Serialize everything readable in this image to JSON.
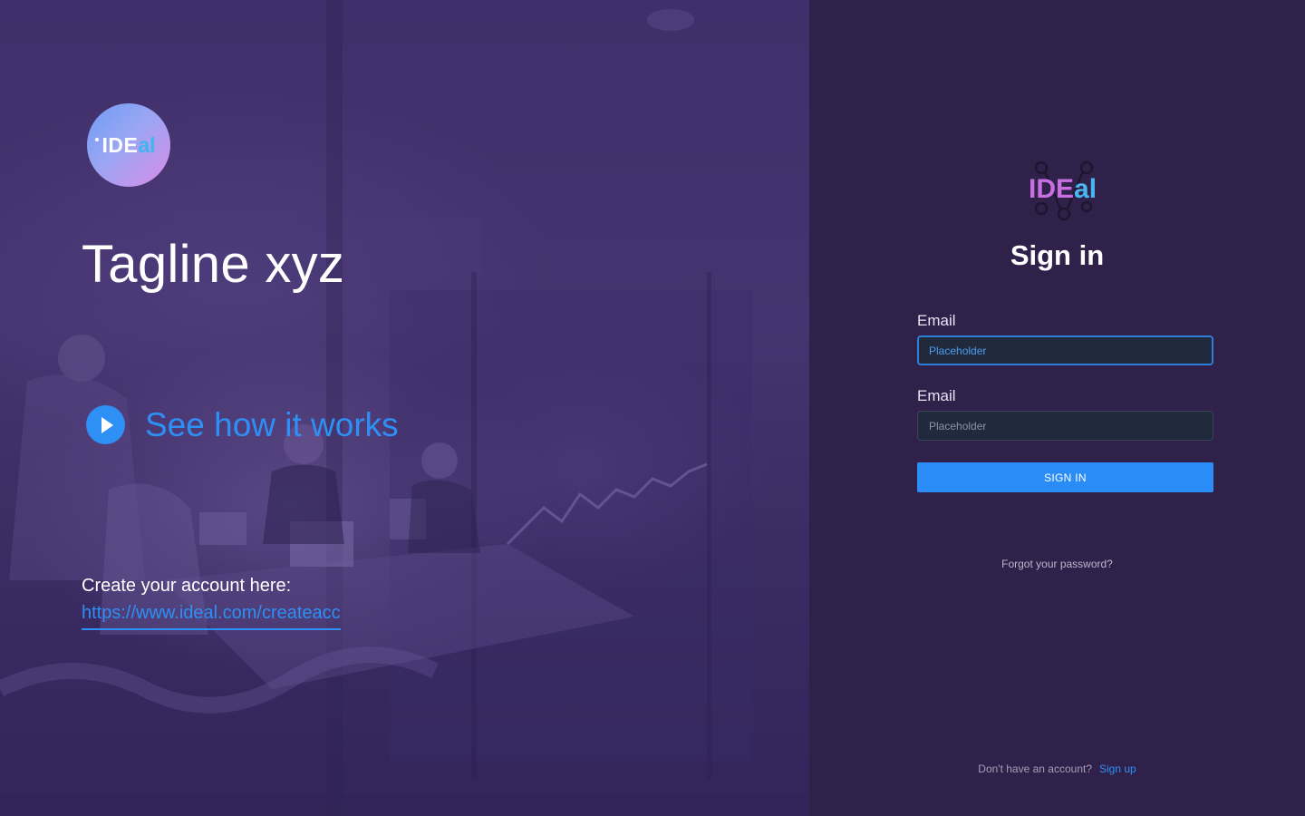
{
  "hero": {
    "logo": {
      "text_main": "IDE",
      "text_accent": "al"
    },
    "tagline": "Tagline xyz",
    "video": {
      "icon": "play-icon",
      "label": "See how it works"
    },
    "create_account": {
      "label": "Create your account here:",
      "url": "https://www.ideal.com/createacc"
    }
  },
  "signin": {
    "brand": {
      "text_main": "IDE",
      "text_accent": "al"
    },
    "title": "Sign in",
    "fields": [
      {
        "label": "Email",
        "placeholder": "Placeholder",
        "value": ""
      },
      {
        "label": "Email",
        "placeholder": "Placeholder",
        "value": ""
      }
    ],
    "submit_label": "SIGN IN",
    "forgot_label": "Forgot your password?",
    "signup_prompt": "Don't have an account?",
    "signup_link": "Sign up"
  },
  "colors": {
    "accent": "#2e8ff5",
    "panel_bg": "#30214a",
    "hero_tint": "#45346f",
    "brand_purple": "#c56fe0",
    "brand_blue": "#49b7ee"
  }
}
